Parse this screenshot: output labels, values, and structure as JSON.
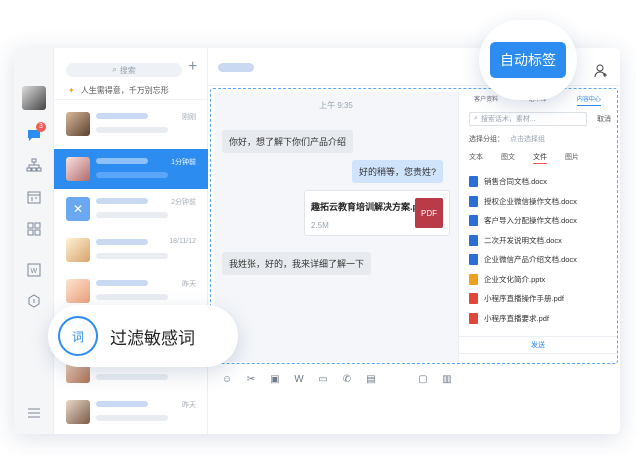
{
  "window": {
    "traffic_lights": [
      "#ff5f57",
      "#febc2e",
      "#28c840"
    ]
  },
  "rail": {
    "badge_count": "3",
    "icons": [
      "chat-icon",
      "org-icon",
      "calendar-icon",
      "apps-icon",
      "word-icon",
      "cube-icon",
      "menu-icon"
    ]
  },
  "list": {
    "search_placeholder": "搜索",
    "notice": "人生需得意，千万别忘形",
    "rows": [
      {
        "time": "刚刚"
      },
      {
        "time": "1分钟前"
      },
      {
        "time": "2分钟前"
      },
      {
        "time": "18/11/12"
      },
      {
        "time": "昨天"
      },
      {
        "time": ""
      },
      {
        "time": "昨天"
      }
    ]
  },
  "chat": {
    "timestamp": "上午 9:35",
    "messages": [
      {
        "dir": "in",
        "text": "你好，想了解下你们产品介绍"
      },
      {
        "dir": "out",
        "text": "好的稍等，您贵姓?"
      },
      {
        "dir": "in",
        "text": "我姓张，好的，我来详细了解一下"
      }
    ],
    "file": {
      "name": "趣拓云教育培训解决方案.pdf",
      "size": "2.5M",
      "type": "PDF"
    }
  },
  "panel": {
    "tabs": [
      "客户资料",
      "话术库",
      "内容中心"
    ],
    "active_tab": "内容中心",
    "search_placeholder": "搜索话术，素材...",
    "cancel": "取消",
    "group_label": "选择分组：",
    "group_value": "点击选择组",
    "file_tabs": [
      "文本",
      "图文",
      "文件",
      "图片"
    ],
    "active_file_tab": "文件",
    "files": [
      {
        "name": "销售合同文档.docx",
        "color": "#2b6fd6"
      },
      {
        "name": "授权企业微信操作文档.docx",
        "color": "#2b6fd6"
      },
      {
        "name": "客户导入分配操作文档.docx",
        "color": "#2b6fd6"
      },
      {
        "name": "二次开发说明文档.docx",
        "color": "#2b6fd6"
      },
      {
        "name": "企业微信产品介绍文档.docx",
        "color": "#2b6fd6"
      },
      {
        "name": "企业文化简介.pptx",
        "color": "#f0a020"
      },
      {
        "name": "小程序直播操作手册.pdf",
        "color": "#e0463a"
      },
      {
        "name": "小程序直播要求.pdf",
        "color": "#e0463a"
      }
    ],
    "send": "发送"
  },
  "callouts": {
    "auto_tag": "自动标签",
    "filter_words": "过滤敏感词",
    "filter_icon_char": "词"
  }
}
